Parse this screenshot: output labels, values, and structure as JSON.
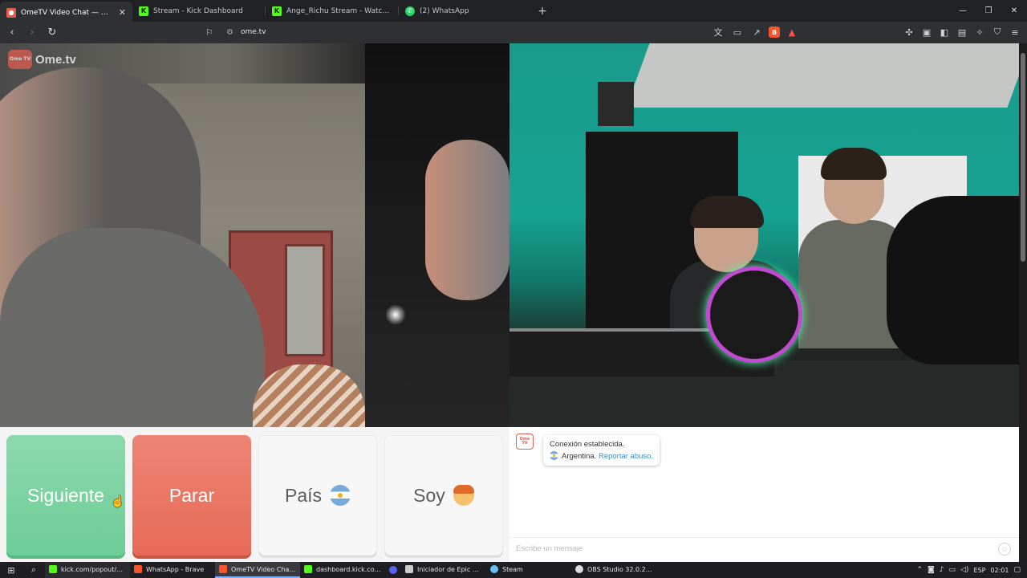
{
  "browser": {
    "tabs": [
      {
        "title": "OmeTV Video Chat — Omegl",
        "favicon": "ome-tv-icon",
        "color": "#e45d4f",
        "active": true
      },
      {
        "title": "Stream - Kick Dashboard",
        "favicon": "kick-icon",
        "color": "#53fc18",
        "active": false
      },
      {
        "title": "Ange_Richu Stream - Watch Live on",
        "favicon": "kick-icon",
        "color": "#53fc18",
        "active": false
      },
      {
        "title": "(2) WhatsApp",
        "favicon": "whatsapp-icon",
        "color": "#25d366",
        "active": false
      }
    ],
    "new_tab_glyph": "+",
    "address": "ome.tv"
  },
  "page": {
    "logo_text": "Ome.tv",
    "logo_badge": "Ome TV",
    "controls": {
      "next_label": "Siguiente",
      "stop_label": "Parar",
      "country_label": "País",
      "gender_label": "Soy"
    },
    "chat": {
      "avatar_text": "Ome TV",
      "connected_text": "Conexión establecida.",
      "country_text": "Argentina.",
      "report_text": "Reportar abuso.",
      "input_placeholder": "Escribe un mensaje"
    }
  },
  "taskbar": {
    "apps": [
      {
        "label": "kick.com/popout/an...",
        "color": "#53fc18",
        "state": "dim"
      },
      {
        "label": "WhatsApp - Brave",
        "color": "#fb542b",
        "state": "normal"
      },
      {
        "label": "OmeTV Video Chat ...",
        "color": "#fb542b",
        "state": "active"
      },
      {
        "label": "dashboard.kick.com...",
        "color": "#53fc18",
        "state": "normal"
      },
      {
        "label": "",
        "color": "#5865f2",
        "state": "small"
      },
      {
        "label": "Iniciador de Epic Ga...",
        "color": "#cccccc",
        "state": "normal"
      },
      {
        "label": "Steam",
        "color": "#66c0f4",
        "state": "normal"
      },
      {
        "label": "OBS Studio 32.0.2 - P...",
        "color": "#dddddd",
        "state": "normal"
      }
    ],
    "language": "ESP",
    "time": "02:01"
  }
}
